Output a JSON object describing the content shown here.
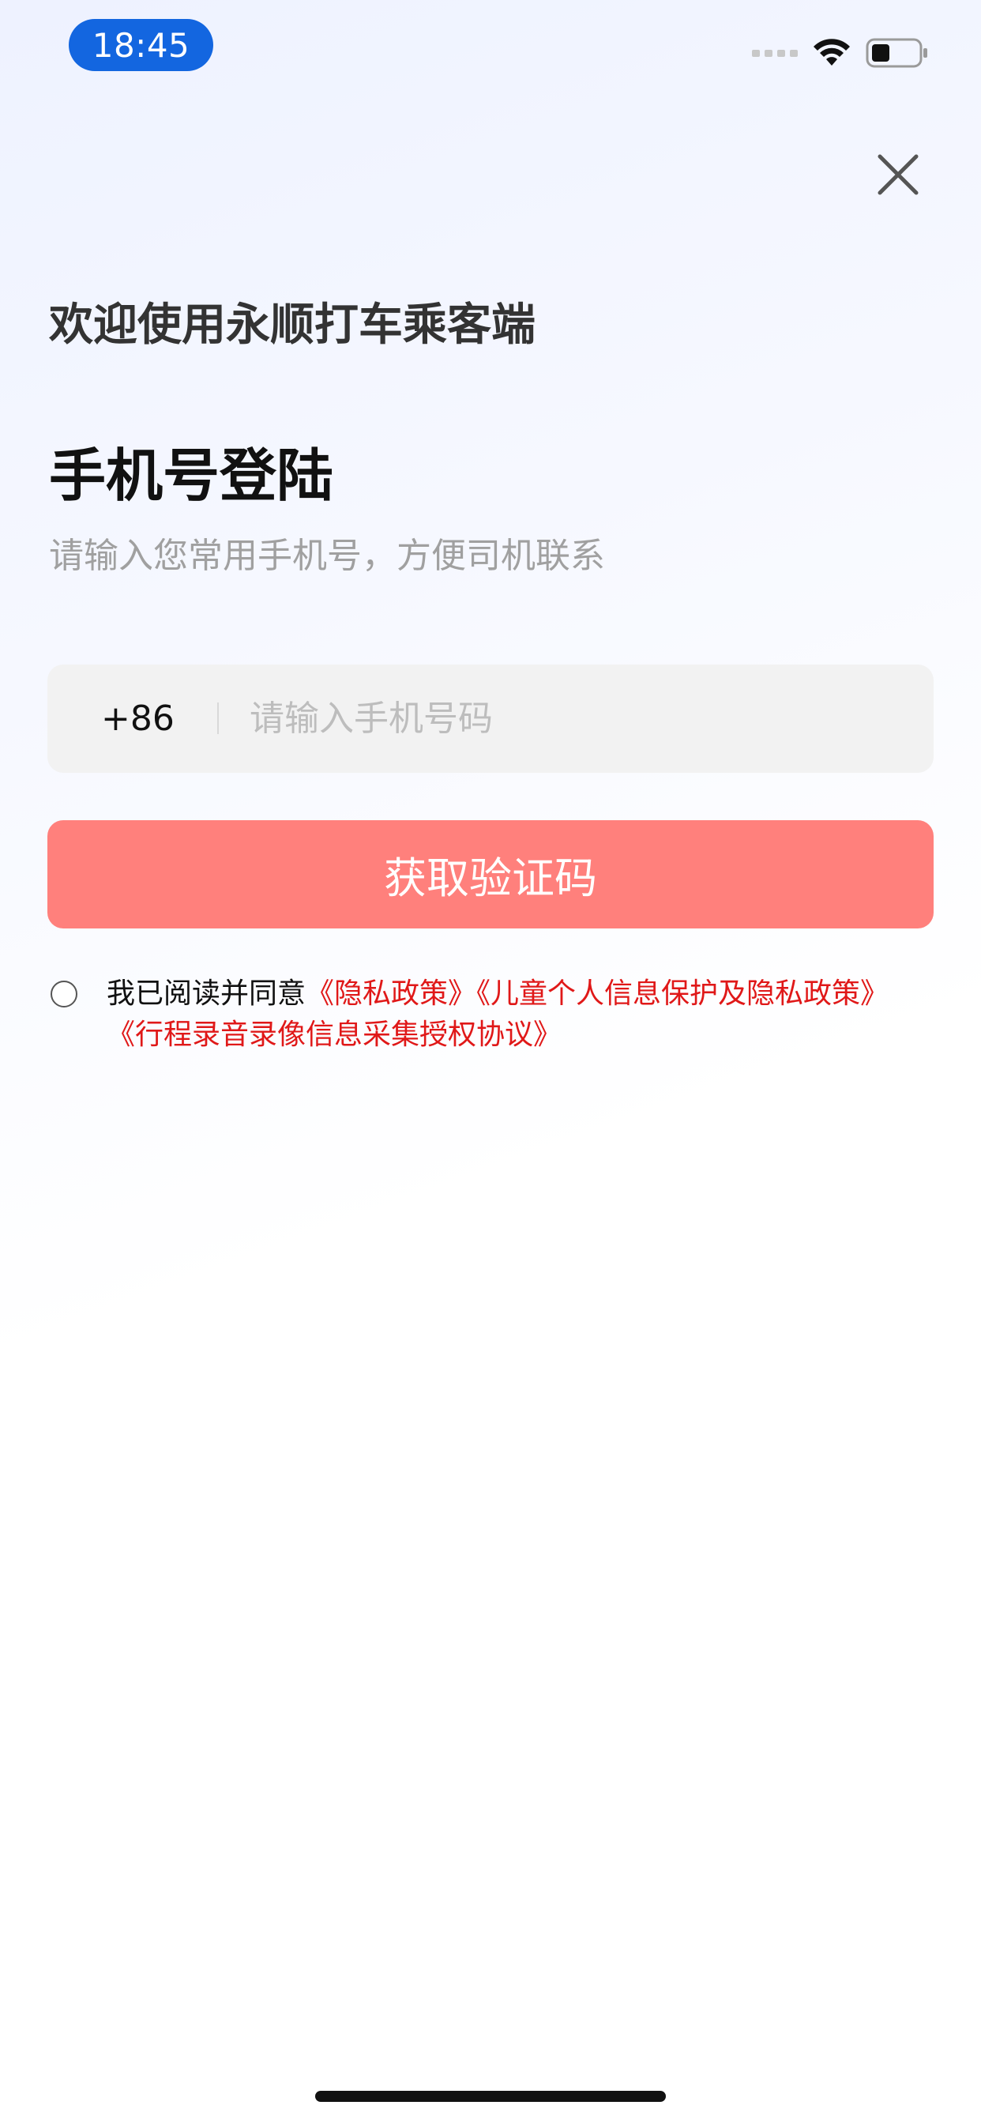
{
  "status_bar": {
    "time": "18:45",
    "icons": [
      "signal-icon",
      "wifi-icon",
      "battery-icon"
    ],
    "time_pill_color": "#1366e0"
  },
  "header": {
    "close_icon": "close-icon"
  },
  "login": {
    "welcome": "欢迎使用永顺打车乘客端",
    "title": "手机号登陆",
    "subtitle": "请输入您常用手机号，方便司机联系",
    "country_code": "+86",
    "phone_placeholder": "请输入手机号码",
    "phone_value": "",
    "submit_label": "获取验证码",
    "submit_color": "#ff807c"
  },
  "agreement": {
    "prefix": "我已阅读并同意",
    "links": [
      "《隐私政策》",
      "《儿童个人信息保护及隐私政策》",
      "《行程录音录像信息采集授权协议》"
    ],
    "link_color": "#e01818"
  }
}
